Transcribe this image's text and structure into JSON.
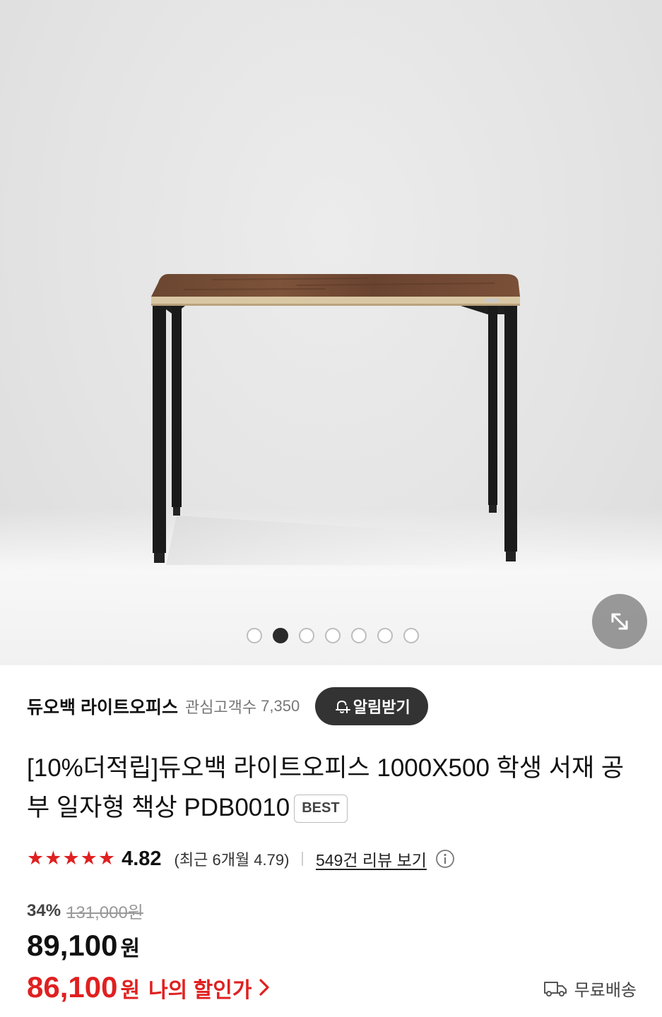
{
  "gallery": {
    "image_alt": "PDB0010 desk product photo",
    "total_images": 7,
    "active_index": 1,
    "expand_icon": "expand-arrows-icon"
  },
  "seller": {
    "name": "듀오백 라이트오피스",
    "fans_label": "관심고객수",
    "fans_count": "7,350",
    "alert_button": "알림받기",
    "alert_icon": "bell-plus-icon"
  },
  "product": {
    "title": "[10%더적립]듀오백 라이트오피스 1000X500 학생 서재 공부 일자형 책상 PDB0010",
    "badge": "BEST"
  },
  "rating": {
    "stars": 5,
    "score": "4.82",
    "recent": "(최근 6개월 4.79)",
    "review_link": "549건 리뷰 보기",
    "info_icon": "info-circle-icon",
    "star_color": "#e02020"
  },
  "price": {
    "discount_rate": "34%",
    "original": "131,000원",
    "sale_number": "89,100",
    "sale_unit": "원",
    "my_price_number": "86,100",
    "my_price_unit": "원",
    "my_price_label": "나의 할인가",
    "accent_color": "#e02020"
  },
  "shipping": {
    "icon": "truck-icon",
    "label": "무료배송"
  }
}
